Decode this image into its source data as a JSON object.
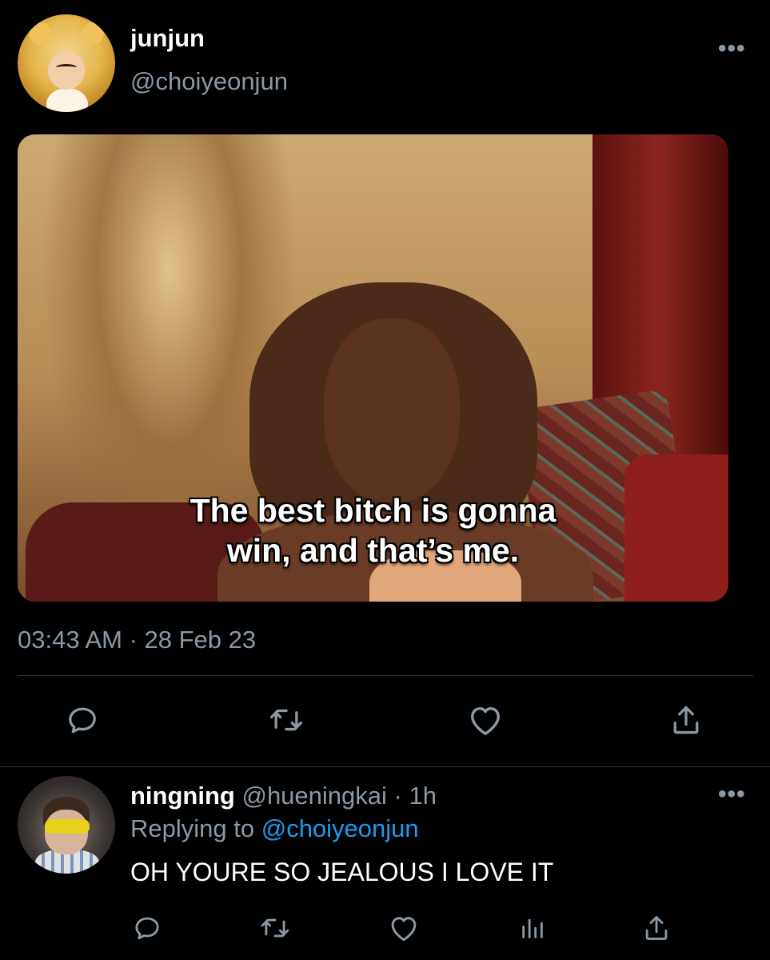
{
  "tweet": {
    "author": {
      "display_name": "junjun",
      "handle": "@choiyeonjun"
    },
    "more_label": "•••",
    "media_caption": {
      "line1": "The best bitch is gonna",
      "line2": "win, and that’s me."
    },
    "timestamp": "03:43 AM · 28 Feb 23",
    "actions": [
      "reply-icon",
      "retweet-icon",
      "like-icon",
      "share-icon"
    ]
  },
  "reply": {
    "display_name": "ningning",
    "handle": "@hueningkai",
    "time": " · 1h",
    "replying_to_prefix": "Replying to ",
    "replying_to_handle": "@choiyeonjun",
    "text": "OH YOURE SO JEALOUS I LOVE IT",
    "more_label": "•••",
    "actions": [
      "reply-icon",
      "retweet-icon",
      "like-icon",
      "analytics-icon",
      "share-icon"
    ]
  },
  "colors": {
    "background": "#000000",
    "primary_text": "#ffffff",
    "secondary_text": "#8b98a5",
    "link": "#1d9bf0",
    "divider": "#2f3336"
  }
}
